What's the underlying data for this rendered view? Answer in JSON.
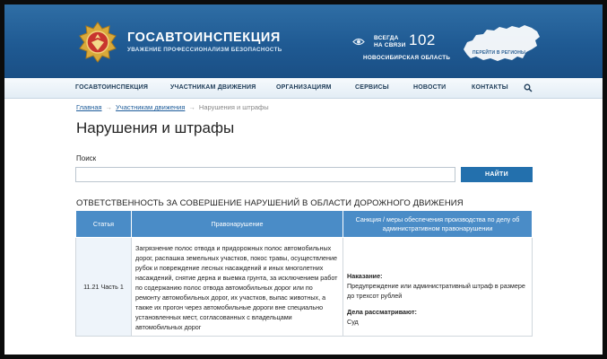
{
  "header": {
    "title": "ГОСАВТОИНСПЕКЦИЯ",
    "tagline": "УВАЖЕНИЕ ПРОФЕССИОНАЛИЗМ БЕЗОПАСНОСТЬ",
    "contact_line1": "ВСЕГДА",
    "contact_line2": "НА СВЯЗИ",
    "phone": "102",
    "region": "НОВОСИБИРСКАЯ ОБЛАСТЬ",
    "map_caption": "ПЕРЕЙТИ В РЕГИОНЫ",
    "logo_icon": "gibdd-emblem-icon",
    "eye_icon": "eye-icon",
    "map_icon": "russia-map-icon"
  },
  "nav": {
    "items": [
      {
        "label": "ГОСАВТОИНСПЕКЦИЯ"
      },
      {
        "label": "УЧАСТНИКАМ ДВИЖЕНИЯ"
      },
      {
        "label": "ОРГАНИЗАЦИЯМ"
      },
      {
        "label": "СЕРВИСЫ"
      },
      {
        "label": "НОВОСТИ"
      },
      {
        "label": "КОНТАКТЫ"
      }
    ],
    "search_icon": "search-icon"
  },
  "breadcrumb": {
    "items": [
      {
        "label": "Главная"
      },
      {
        "label": "Участникам движения"
      },
      {
        "label": "Нарушения и штрафы"
      }
    ],
    "separator": "→"
  },
  "page_title": "Нарушения и штрафы",
  "search": {
    "label": "Поиск",
    "value": "",
    "button": "НАЙТИ"
  },
  "section_heading": "ОТВЕТСТВЕННОСТЬ ЗА СОВЕРШЕНИЕ НАРУШЕНИЙ В ОБЛАСТИ ДОРОЖНОГО ДВИЖЕНИЯ",
  "table": {
    "headers": [
      "Статья",
      "Правонарушение",
      "Санкция / меры обеспечения производства по делу об административном правонарушении"
    ],
    "rows": [
      {
        "article": "11.21 Часть 1",
        "offense": "Загрязнение полос отвода и придорожных полос автомобильных дорог, распашка земельных участков, покос травы, осуществление рубок и повреждение лесных насаждений и иных многолетних насаждений, снятие дерна и выемка грунта, за исключением работ по содержанию полос отвода автомобильных дорог или по ремонту автомобильных дорог, их участков, выпас животных, а также их прогон через автомобильные дороги вне специально установленных мест, согласованных с владельцами автомобильных дорог",
        "punishment_label": "Наказание:",
        "punishment": "Предупреждение или административный штраф в размере до трехсот рублей",
        "reviewer_label": "Дела рассматривают:",
        "reviewer": "Суд"
      }
    ]
  },
  "colors": {
    "header_bg": "#1f5a93",
    "button": "#2370ad",
    "table_header": "#4a8cc7",
    "link": "#1f5d9a"
  }
}
